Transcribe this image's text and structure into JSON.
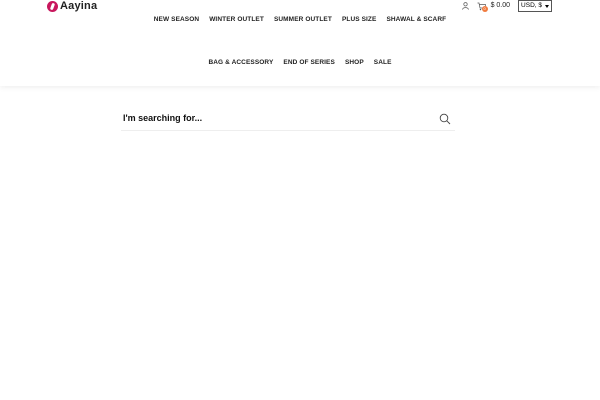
{
  "brand": {
    "name": "Aayina",
    "logo_icon": "logo-mark-icon",
    "accent": "#c8175d"
  },
  "utility": {
    "user_icon": "user-icon",
    "cart_icon": "cart-icon",
    "cart_count": "0",
    "cart_total": "$ 0.00",
    "currency_selected": "USD, $"
  },
  "nav": {
    "row1": [
      "NEW SEASON",
      "WINTER OUTLET",
      "SUMMER OUTLET",
      "PLUS SIZE",
      "SHAWAL & SCARF"
    ],
    "row2": [
      "BAG & ACCESSORY",
      "END OF SERIES",
      "SHOP",
      "SALE"
    ]
  },
  "search": {
    "placeholder": "I'm searching for...",
    "value": "",
    "icon": "search-icon"
  }
}
